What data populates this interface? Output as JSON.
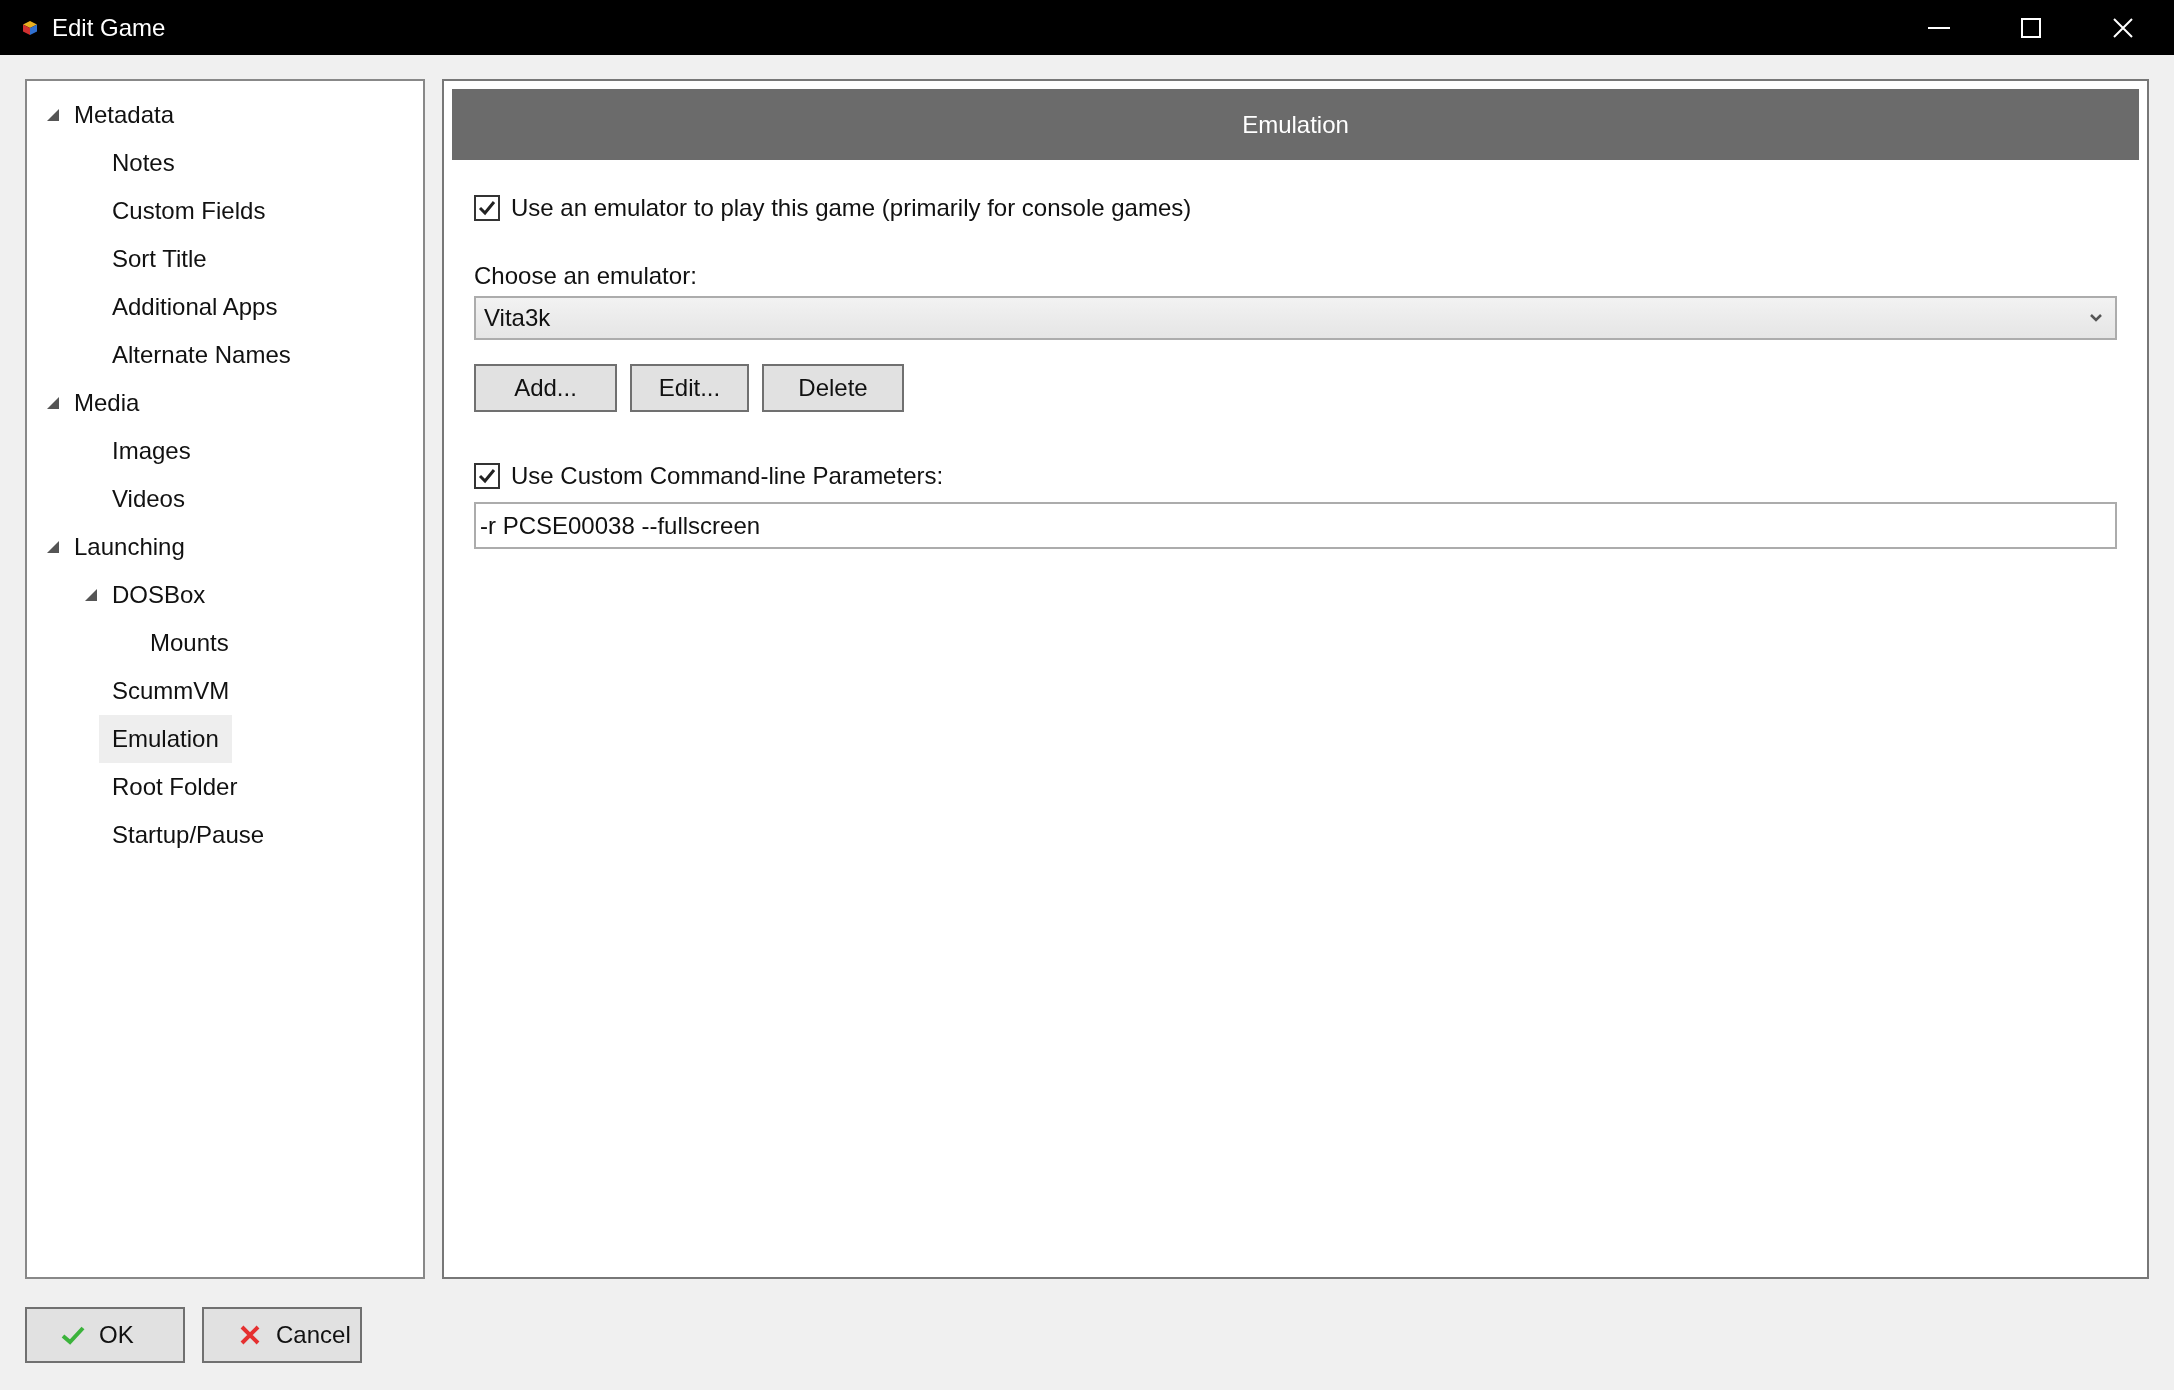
{
  "window": {
    "title": "Edit Game"
  },
  "tree": [
    {
      "label": "Metadata",
      "expanded": true,
      "selected": false,
      "children": [
        {
          "label": "Notes",
          "selected": false
        },
        {
          "label": "Custom Fields",
          "selected": false
        },
        {
          "label": "Sort Title",
          "selected": false
        },
        {
          "label": "Additional Apps",
          "selected": false
        },
        {
          "label": "Alternate Names",
          "selected": false
        }
      ]
    },
    {
      "label": "Media",
      "expanded": true,
      "selected": false,
      "children": [
        {
          "label": "Images",
          "selected": false
        },
        {
          "label": "Videos",
          "selected": false
        }
      ]
    },
    {
      "label": "Launching",
      "expanded": true,
      "selected": false,
      "children": [
        {
          "label": "DOSBox",
          "expanded": true,
          "selected": false,
          "children": [
            {
              "label": "Mounts",
              "selected": false
            }
          ]
        },
        {
          "label": "ScummVM",
          "selected": false
        },
        {
          "label": "Emulation",
          "selected": true
        },
        {
          "label": "Root Folder",
          "selected": false
        },
        {
          "label": "Startup/Pause",
          "selected": false
        }
      ]
    }
  ],
  "panel": {
    "header": "Emulation",
    "use_emulator": {
      "label": "Use an emulator to play this game (primarily for console games)",
      "checked": true
    },
    "emulator_label": "Choose an emulator:",
    "emulator": {
      "value": "Vita3k"
    },
    "emulator_buttons": [
      "Add...",
      "Edit...",
      "Delete"
    ],
    "use_custom_params": {
      "label": "Use Custom Command-line Parameters:",
      "checked": true
    },
    "params": {
      "value": "-r PCSE00038 --fullscreen"
    }
  },
  "buttons": [
    {
      "kind": "ok",
      "label": "OK"
    },
    {
      "kind": "cancel",
      "label": "Cancel"
    }
  ]
}
